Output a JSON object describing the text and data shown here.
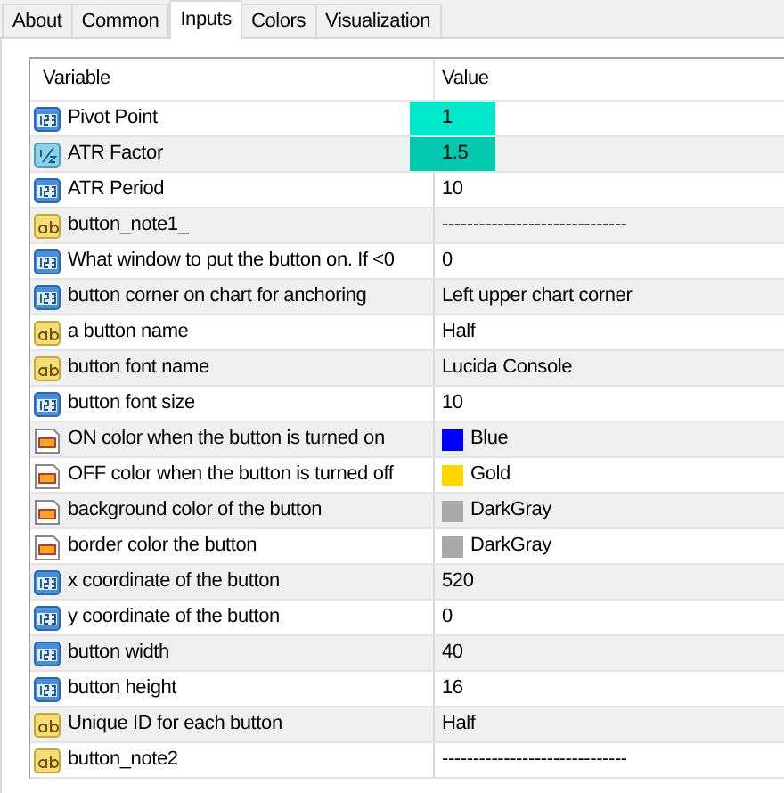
{
  "tabs": [
    {
      "label": "About",
      "selected": false
    },
    {
      "label": "Common",
      "selected": false
    },
    {
      "label": "Inputs",
      "selected": true
    },
    {
      "label": "Colors",
      "selected": false
    },
    {
      "label": "Visualization",
      "selected": false
    }
  ],
  "table": {
    "columns": [
      "Variable",
      "Value"
    ],
    "rows": [
      {
        "kind": "int",
        "variable": "Pivot Point",
        "value": "1",
        "highlighted": true
      },
      {
        "kind": "double",
        "variable": "ATR Factor",
        "value": "1.5",
        "highlighted": true
      },
      {
        "kind": "int",
        "variable": "ATR Period",
        "value": "10",
        "highlighted": false
      },
      {
        "kind": "string",
        "variable": "button_note1_",
        "value": "------------------------------",
        "highlighted": false
      },
      {
        "kind": "int",
        "variable": "What window to put the button on.  If <0",
        "value": "0",
        "highlighted": false
      },
      {
        "kind": "int",
        "variable": "button corner on chart for anchoring",
        "value": "Left upper chart corner",
        "highlighted": false
      },
      {
        "kind": "string",
        "variable": "a button name",
        "value": "Half",
        "highlighted": false
      },
      {
        "kind": "string",
        "variable": "button font name",
        "value": "Lucida Console",
        "highlighted": false
      },
      {
        "kind": "int",
        "variable": "button font size",
        "value": "10",
        "highlighted": false
      },
      {
        "kind": "color",
        "variable": "ON color when the button is turned on",
        "value": "Blue",
        "color": "#0000ff",
        "highlighted": false
      },
      {
        "kind": "color",
        "variable": "OFF color when the button is turned off",
        "value": "Gold",
        "color": "#ffd700",
        "highlighted": false
      },
      {
        "kind": "color",
        "variable": "background color of the button",
        "value": "DarkGray",
        "color": "#a9a9a9",
        "highlighted": false
      },
      {
        "kind": "color",
        "variable": "border color the button",
        "value": "DarkGray",
        "color": "#a9a9a9",
        "highlighted": false
      },
      {
        "kind": "int",
        "variable": "x coordinate of the button",
        "value": "520",
        "highlighted": false
      },
      {
        "kind": "int",
        "variable": "y coordinate of the button",
        "value": "0",
        "highlighted": false
      },
      {
        "kind": "int",
        "variable": "button width",
        "value": "40",
        "highlighted": false
      },
      {
        "kind": "int",
        "variable": "button height",
        "value": "16",
        "highlighted": false
      },
      {
        "kind": "string",
        "variable": "Unique ID for each button",
        "value": "Half",
        "highlighted": false
      },
      {
        "kind": "string",
        "variable": "button_note2",
        "value": "------------------------------",
        "highlighted": false
      }
    ]
  }
}
